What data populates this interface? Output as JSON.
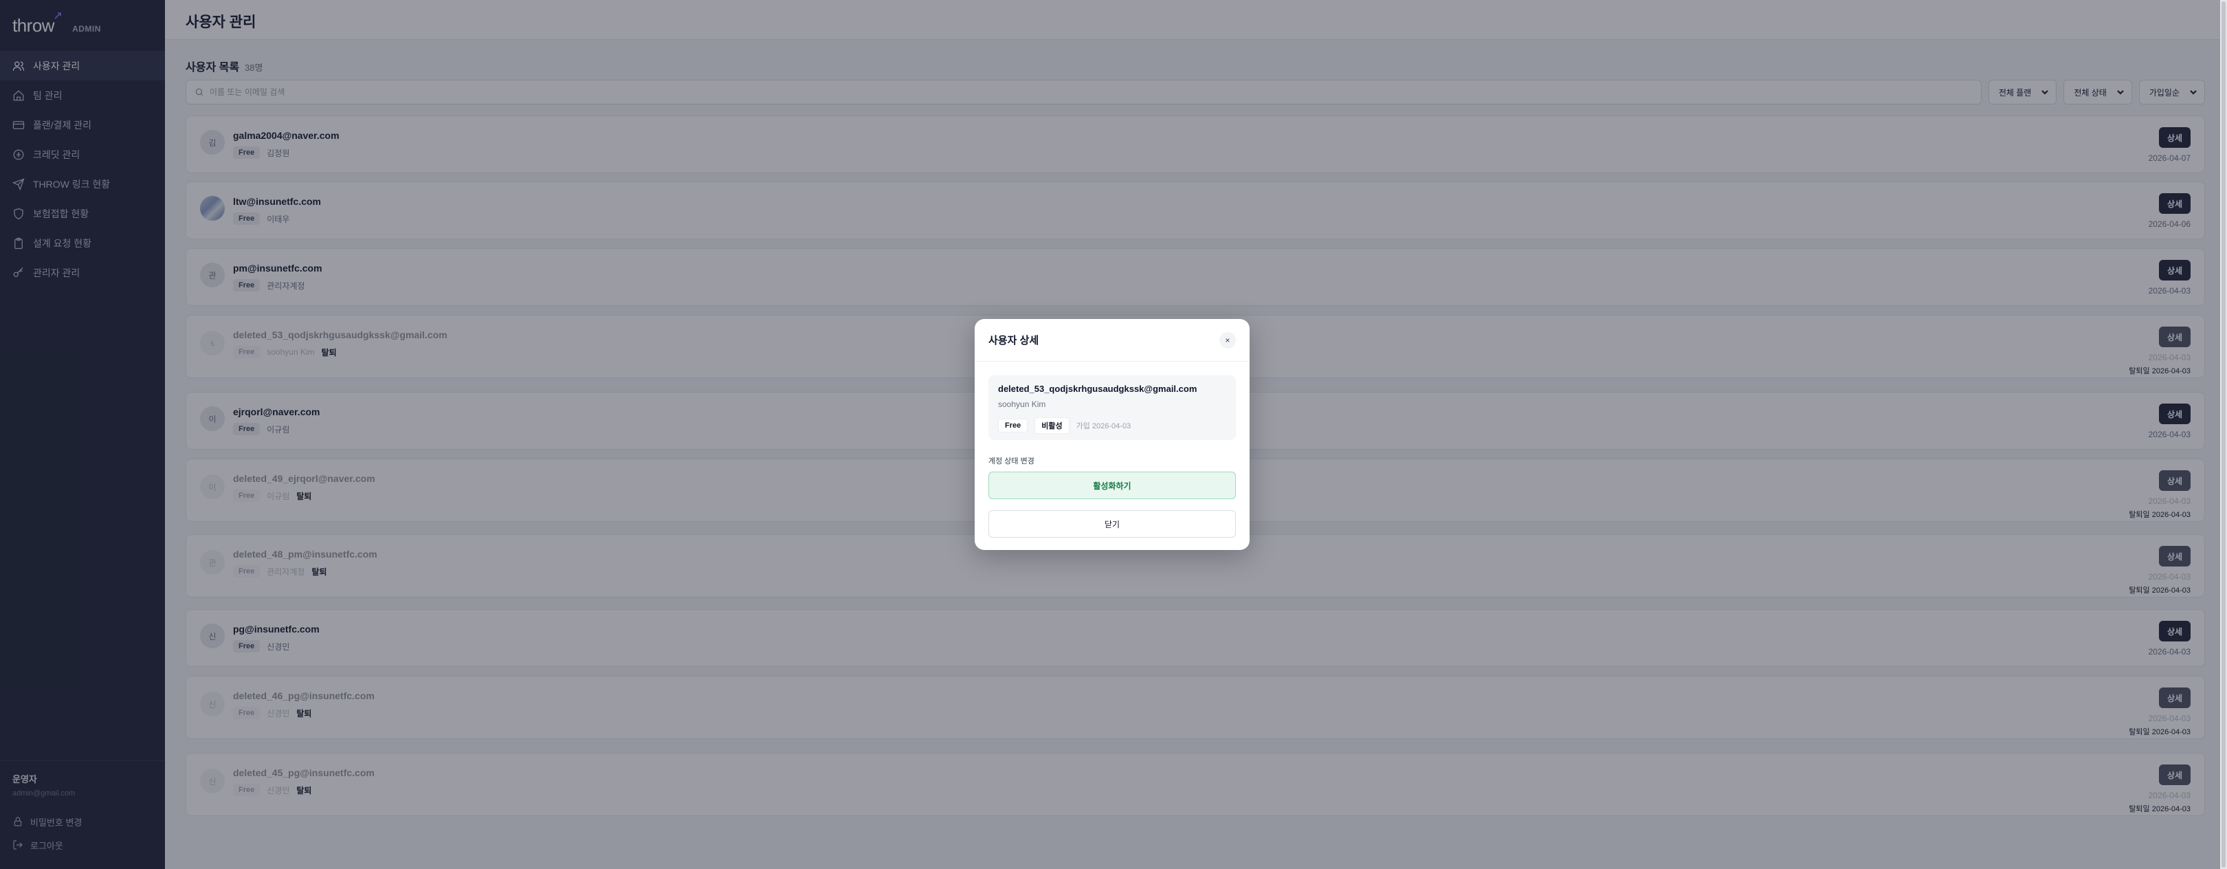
{
  "brand": {
    "logo": "throw",
    "admin_label": "ADMIN"
  },
  "sidebar": {
    "items": [
      {
        "label": "사용자 관리",
        "icon": "users-icon",
        "active": true
      },
      {
        "label": "팀 관리",
        "icon": "home-icon",
        "active": false
      },
      {
        "label": "플랜/결제 관리",
        "icon": "card-icon",
        "active": false
      },
      {
        "label": "크레딧 관리",
        "icon": "credit-icon",
        "active": false
      },
      {
        "label": "THROW 링크 현황",
        "icon": "send-icon",
        "active": false
      },
      {
        "label": "보험접합 현황",
        "icon": "shield-icon",
        "active": false
      },
      {
        "label": "설계 요청 현황",
        "icon": "clipboard-icon",
        "active": false
      },
      {
        "label": "관리자 관리",
        "icon": "key-icon",
        "active": false
      }
    ],
    "operator_name": "운영자",
    "operator_email": "admin@gmail.com",
    "change_password": "비밀번호 변경",
    "logout": "로그아웃"
  },
  "header": {
    "title": "사용자 관리"
  },
  "list": {
    "title": "사용자 목록",
    "count": "38명",
    "search_placeholder": "이름 또는 이메일 검색",
    "filters": [
      "전체 플랜",
      "전체 상태",
      "가입일순"
    ],
    "detail_label": "상세",
    "withdrawn_label": "탈퇴",
    "rows": [
      {
        "initial": "김",
        "email": "galma2004@naver.com",
        "plan": "Free",
        "name": "김정원",
        "joined": "2026-04-07",
        "deleted": false,
        "withdrawn": ""
      },
      {
        "initial": "",
        "email": "ltw@insunetfc.com",
        "plan": "Free",
        "name": "이태우",
        "joined": "2026-04-06",
        "deleted": false,
        "withdrawn": "",
        "photo": true
      },
      {
        "initial": "관",
        "email": "pm@insunetfc.com",
        "plan": "Free",
        "name": "관리자계정",
        "joined": "2026-04-03",
        "deleted": false,
        "withdrawn": ""
      },
      {
        "initial": "s",
        "email": "deleted_53_qodjskrhgusaudgkssk@gmail.com",
        "plan": "Free",
        "name": "soohyun Kim",
        "joined": "2026-04-03",
        "deleted": true,
        "withdrawn": "탈퇴일 2026-04-03"
      },
      {
        "initial": "이",
        "email": "ejrqorl@naver.com",
        "plan": "Free",
        "name": "이규림",
        "joined": "2026-04-03",
        "deleted": false,
        "withdrawn": ""
      },
      {
        "initial": "이",
        "email": "deleted_49_ejrqorl@naver.com",
        "plan": "Free",
        "name": "이규림",
        "joined": "2026-04-03",
        "deleted": true,
        "withdrawn": "탈퇴일 2026-04-03"
      },
      {
        "initial": "관",
        "email": "deleted_48_pm@insunetfc.com",
        "plan": "Free",
        "name": "관리자계정",
        "joined": "2026-04-03",
        "deleted": true,
        "withdrawn": "탈퇴일 2026-04-03"
      },
      {
        "initial": "신",
        "email": "pg@insunetfc.com",
        "plan": "Free",
        "name": "신경민",
        "joined": "2026-04-03",
        "deleted": false,
        "withdrawn": ""
      },
      {
        "initial": "신",
        "email": "deleted_46_pg@insunetfc.com",
        "plan": "Free",
        "name": "신경민",
        "joined": "2026-04-03",
        "deleted": true,
        "withdrawn": "탈퇴일 2026-04-03"
      },
      {
        "initial": "신",
        "email": "deleted_45_pg@insunetfc.com",
        "plan": "Free",
        "name": "신경민",
        "joined": "2026-04-03",
        "deleted": true,
        "withdrawn": "탈퇴일 2026-04-03"
      }
    ]
  },
  "modal": {
    "title": "사용자 상세",
    "close_symbol": "×",
    "email": "deleted_53_qodjskrhgusaudgkssk@gmail.com",
    "name": "soohyun Kim",
    "plan": "Free",
    "status": "비활성",
    "joined": "가입 2026-04-03",
    "section_label": "계정 상태 변경",
    "activate_label": "활성화하기",
    "close_label": "닫기"
  },
  "colors": {
    "sidebar_bg": "#1c2233",
    "accent_green": "#137a43",
    "button_dark": "#1c2233"
  }
}
